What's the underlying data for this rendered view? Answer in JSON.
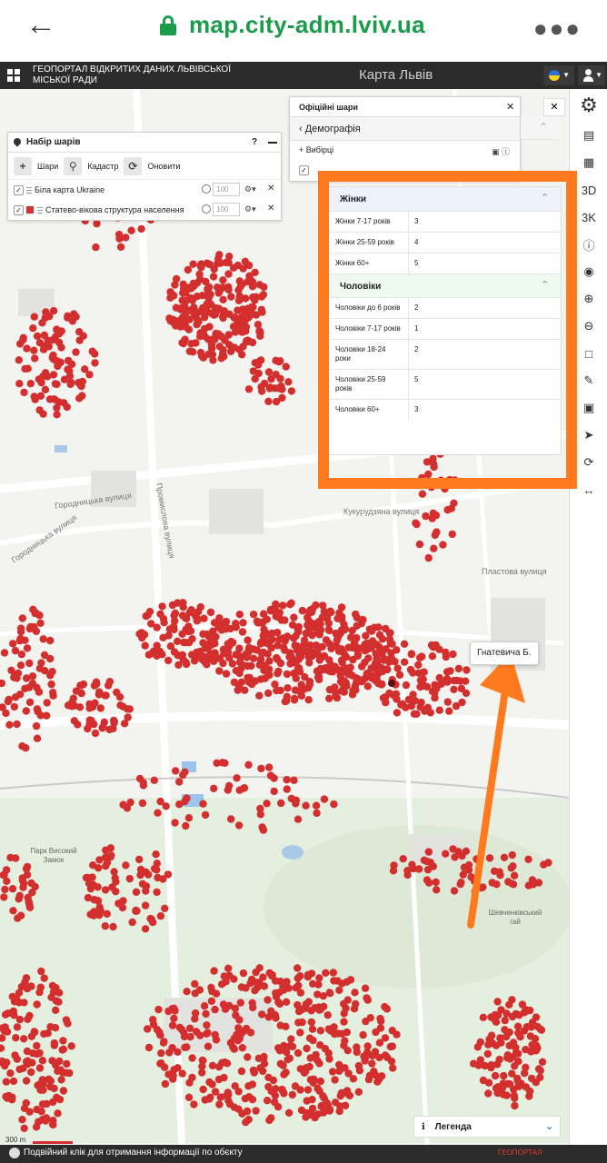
{
  "browser": {
    "url": "map.city-adm.lviv.ua",
    "back_icon": "arrow-left-icon",
    "menu_icon": "more-vert-icon"
  },
  "app": {
    "title": "ГЕОПОРТАЛ ВІДКРИТИХ ДАНИХ ЛЬВІВСЬКОЇ МІСЬКОЇ РАДИ",
    "map_title": "Карта Львів"
  },
  "layers_panel": {
    "title": "Набір шарів",
    "help": "?",
    "buttons": [
      "Шари",
      "Кадастр",
      "Оновити"
    ],
    "rows": [
      {
        "name": "Біла карта Ukraine",
        "opacity": "100"
      },
      {
        "name": "Статево-вікова структура населення",
        "opacity": "100"
      }
    ]
  },
  "official_layers": {
    "tab": "Офіційні шари",
    "category": "Демографія",
    "row": "Вибірці"
  },
  "info": {
    "women_title": "Жінки",
    "women_rows": [
      {
        "k": "Жінки 7-17 років",
        "v": "3"
      },
      {
        "k": "Жінки 25-59 років",
        "v": "4"
      },
      {
        "k": "Жінки 60+",
        "v": "5"
      }
    ],
    "men_title": "Чоловіки",
    "men_rows": [
      {
        "k": "Чоловіки до 6 років",
        "v": "2"
      },
      {
        "k": "Чоловіки 7-17 років",
        "v": "1"
      },
      {
        "k": "Чоловіки 18-24 роки",
        "v": "2"
      },
      {
        "k": "Чоловіки 25-59 років",
        "v": "5"
      },
      {
        "k": "Чоловіки 60+",
        "v": "3"
      }
    ]
  },
  "map_labels": {
    "street1": "Городницька вулиця",
    "street2": "Городницька вулиця",
    "street3": "Кукурудзяна вулиця",
    "street4": "Пластова вулиця",
    "street5": "Промислова вулиця",
    "park": "Парк Високий Замок",
    "grove": "Шевченківський гай",
    "scale": "300 m"
  },
  "tooltip": "Гнатевича Б.",
  "legend": "Легенда",
  "status_text": "Подвійний клік для отримання інформації по обєкту",
  "brand": "ГЕОПОРТАЛ",
  "colors": {
    "dots": "#d32f2f",
    "accent_orange": "#ff7a1f",
    "url_green": "#1a9c4b"
  }
}
